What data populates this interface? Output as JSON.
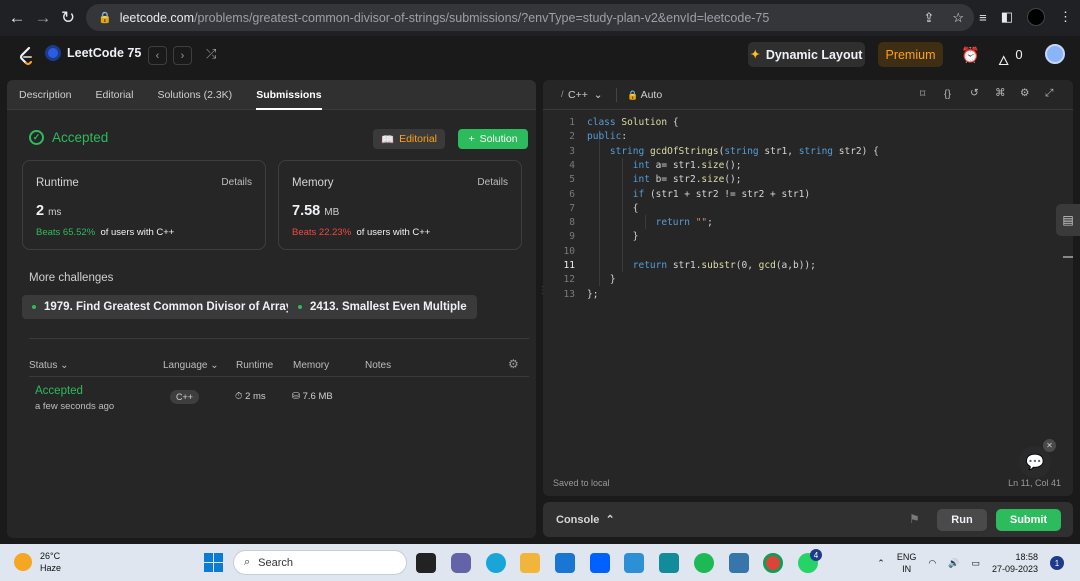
{
  "browser": {
    "url_host": "leetcode.com",
    "url_path": "/problems/greatest-common-divisor-of-strings/submissions/?envType=study-plan-v2&envId=leetcode-75"
  },
  "header": {
    "study_plan": "LeetCode 75",
    "dynamic_layout": "Dynamic Layout",
    "premium": "Premium",
    "streak": "0"
  },
  "left_tabs": [
    "Description",
    "Editorial",
    "Solutions (2.3K)",
    "Submissions"
  ],
  "result": {
    "status": "Accepted",
    "editorial_btn": "Editorial",
    "solution_btn": "Solution",
    "runtime": {
      "title": "Runtime",
      "details": "Details",
      "value": "2",
      "unit": "ms",
      "beats": "Beats 65.52%",
      "beats_suffix": "of users with C++"
    },
    "memory": {
      "title": "Memory",
      "details": "Details",
      "value": "7.58",
      "unit": "MB",
      "beats": "Beats 22.23%",
      "beats_suffix": "of users with C++"
    }
  },
  "more_challenges": {
    "title": "More challenges",
    "items": [
      "1979. Find Greatest Common Divisor of Array",
      "2413. Smallest Even Multiple"
    ]
  },
  "table": {
    "headers": [
      "Status",
      "Language",
      "Runtime",
      "Memory",
      "Notes"
    ],
    "row": {
      "status": "Accepted",
      "time": "a few seconds ago",
      "language": "C++",
      "runtime": "2 ms",
      "memory": "7.6 MB"
    }
  },
  "editor": {
    "language": "C++",
    "mode": "Auto",
    "line_numbers": [
      "1",
      "2",
      "3",
      "4",
      "5",
      "6",
      "7",
      "8",
      "9",
      "10",
      "11",
      "12",
      "13"
    ],
    "saved": "Saved to local",
    "cursor": "Ln 11, Col 41"
  },
  "console": {
    "label": "Console",
    "run": "Run",
    "submit": "Submit"
  },
  "taskbar": {
    "temp": "26°C",
    "weather": "Haze",
    "search": "Search",
    "lang": "ENG",
    "region": "IN",
    "time": "18:58",
    "date": "27-09-2023",
    "notifications": "1",
    "whatsapp_badge": "4"
  }
}
